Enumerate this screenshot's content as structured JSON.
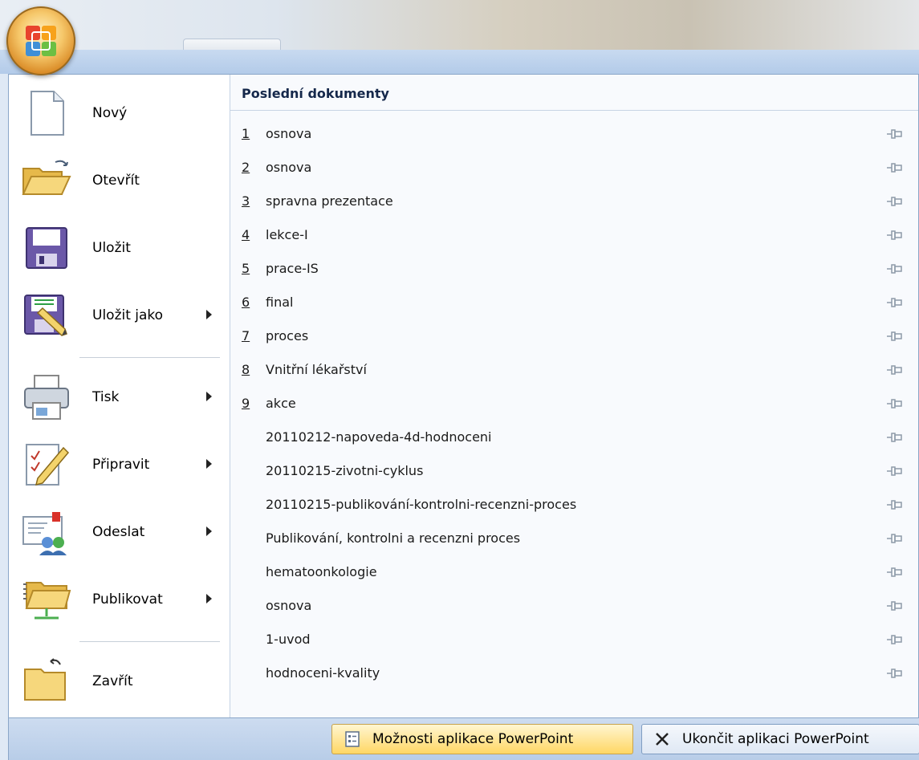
{
  "menu": {
    "commands": [
      {
        "id": "new",
        "label": "Nový",
        "icon": "new-document-icon",
        "submenu": false
      },
      {
        "id": "open",
        "label": "Otevřít",
        "icon": "open-folder-icon",
        "submenu": false
      },
      {
        "id": "save",
        "label": "Uložit",
        "icon": "save-disk-icon",
        "submenu": false
      },
      {
        "id": "save-as",
        "label": "Uložit jako",
        "icon": "save-as-icon",
        "submenu": true
      },
      {
        "id": "print",
        "label": "Tisk",
        "icon": "printer-icon",
        "submenu": true
      },
      {
        "id": "prepare",
        "label": "Připravit",
        "icon": "prepare-pencil-icon",
        "submenu": true
      },
      {
        "id": "send",
        "label": "Odeslat",
        "icon": "send-icon",
        "submenu": true
      },
      {
        "id": "publish",
        "label": "Publikovat",
        "icon": "publish-folder-icon",
        "submenu": true
      },
      {
        "id": "close",
        "label": "Zavřít",
        "icon": "close-folder-icon",
        "submenu": false
      }
    ]
  },
  "recent": {
    "title": "Poslední dokumenty",
    "items": [
      {
        "num": "1",
        "name": "osnova"
      },
      {
        "num": "2",
        "name": "osnova"
      },
      {
        "num": "3",
        "name": "spravna prezentace"
      },
      {
        "num": "4",
        "name": "lekce-I"
      },
      {
        "num": "5",
        "name": "prace-IS"
      },
      {
        "num": "6",
        "name": "final"
      },
      {
        "num": "7",
        "name": "proces"
      },
      {
        "num": "8",
        "name": "Vnitřní lékařství"
      },
      {
        "num": "9",
        "name": "akce"
      },
      {
        "num": "",
        "name": "20110212-napoveda-4d-hodnoceni"
      },
      {
        "num": "",
        "name": "20110215-zivotni-cyklus"
      },
      {
        "num": "",
        "name": "20110215-publikování-kontrolni-recenzni-proces"
      },
      {
        "num": "",
        "name": "Publikování, kontrolni a recenzni proces"
      },
      {
        "num": "",
        "name": "hematoonkologie"
      },
      {
        "num": "",
        "name": "osnova"
      },
      {
        "num": "",
        "name": "1-uvod"
      },
      {
        "num": "",
        "name": "hodnoceni-kvality"
      }
    ]
  },
  "footer": {
    "options_label": "Možnosti aplikace PowerPoint",
    "exit_label": "Ukončit aplikaci PowerPoint"
  },
  "colors": {
    "accent": "#ffd764",
    "frame": "#8aa6c8"
  }
}
